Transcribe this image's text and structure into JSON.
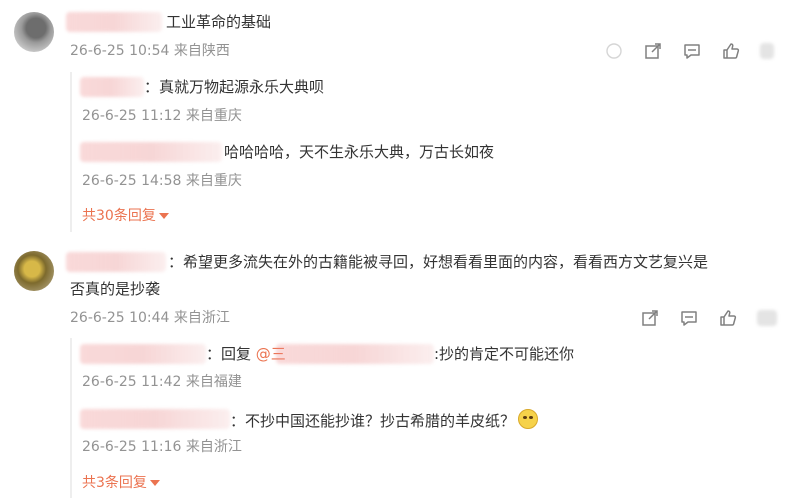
{
  "comments": [
    {
      "text": "工业革命的基础",
      "meta": "26-6-25 10:54 来自陕西",
      "replies": [
        {
          "text": "：真就万物起源永乐大典呗",
          "meta": "26-6-25 11:12 来自重庆"
        },
        {
          "text": "哈哈哈哈，天不生永乐大典，万古长如夜",
          "meta": "26-6-25 14:58 来自重庆"
        }
      ],
      "more_replies": "共30条回复"
    },
    {
      "text_line1": "：希望更多流失在外的古籍能被寻回，好想看看里面的内容，看看西方文艺复兴是",
      "text_line2": "否真的是抄袭",
      "meta": "26-6-25 10:44 来自浙江",
      "replies": [
        {
          "prefix": "：回复",
          "mention": "@三",
          "suffix": ":抄的肯定不可能还你",
          "meta": "26-6-25 11:42 来自福建"
        },
        {
          "text": "：不抄中国还能抄谁？抄古希腊的羊皮纸？",
          "meta": "26-6-25 11:16 来自浙江"
        }
      ],
      "more_replies": "共3条回复"
    }
  ],
  "icons": {
    "share": "share-icon",
    "comment": "comment-icon",
    "like": "thumb-up-icon"
  }
}
